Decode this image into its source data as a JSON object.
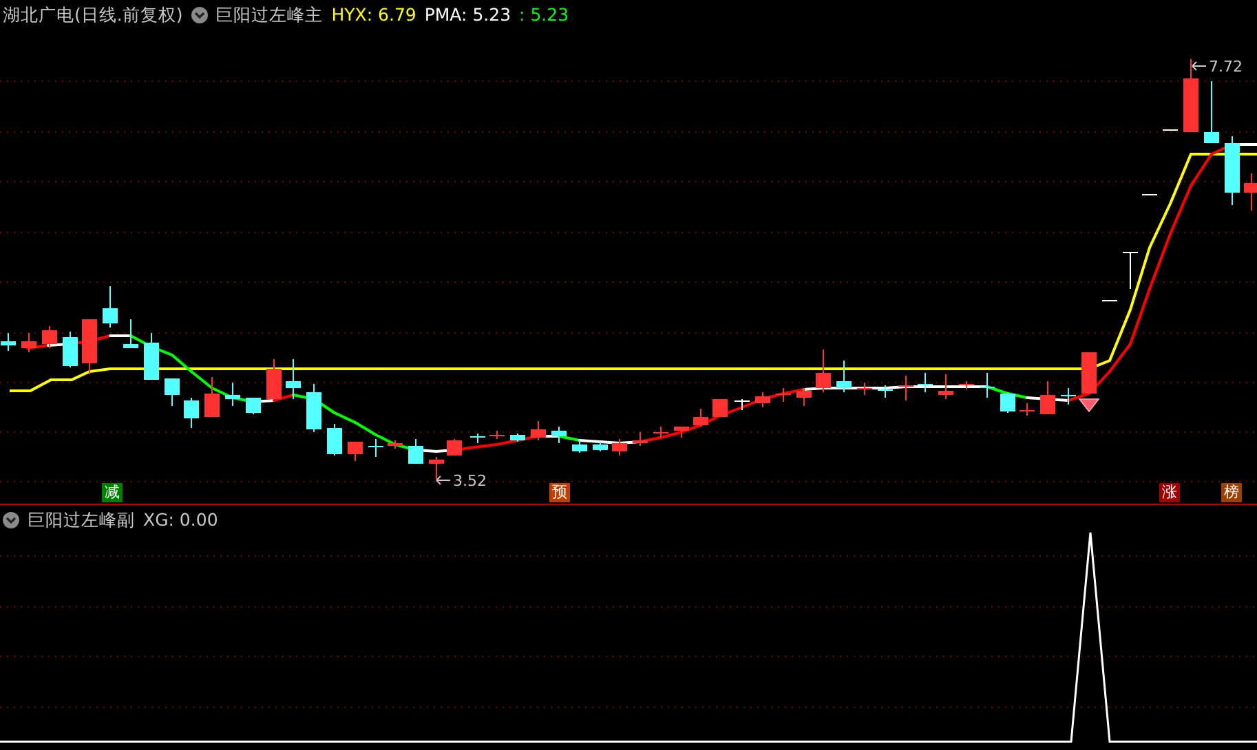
{
  "main_panel": {
    "title": "湖北广电(日线.前复权)",
    "indicator": "巨阳过左峰主",
    "readings": [
      {
        "text": "HYX: 6.79",
        "color": "#ffff00"
      },
      {
        "text": "PMA: 5.23",
        "color": "#ffffff"
      },
      {
        "text": ": 5.23",
        "color": "#00ff00"
      }
    ],
    "high_label": "7.72",
    "low_label": "3.52",
    "signals": [
      {
        "text": "减",
        "color": "#008000"
      },
      {
        "text": "预",
        "color": "#c04000"
      },
      {
        "text": "涨",
        "color": "#a00000"
      },
      {
        "text": "榜",
        "color": "#a04000"
      }
    ]
  },
  "sub_panel": {
    "indicator": "巨阳过左峰副",
    "reading": "XG: 0.00"
  }
}
